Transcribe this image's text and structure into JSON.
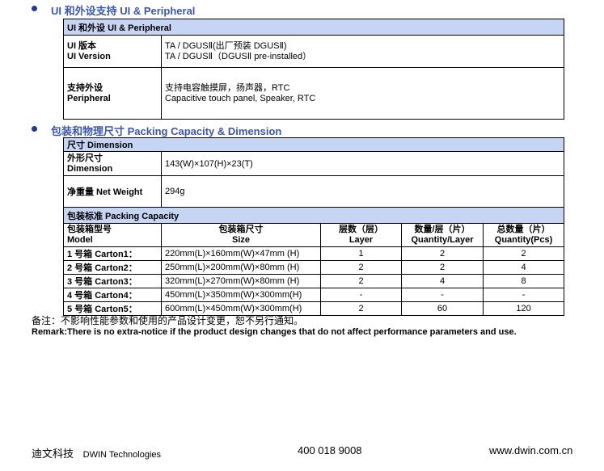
{
  "section_ui": {
    "title": "UI 和外设支持  UI & Peripheral",
    "header": "UI 和外设  UI & Peripheral",
    "rows": [
      {
        "label_cn": "UI 版本",
        "label_en": "UI Version",
        "value_cn": "TA / DGUSⅡ(出厂预装 DGUSⅡ)",
        "value_en": "TA / DGUSⅡ（DGUSⅡ pre-installed）"
      },
      {
        "label_cn": "支持外设",
        "label_en": "Peripheral",
        "value_cn": "支持电容触摸屏，扬声器，RTC",
        "value_en": "Capacitive touch panel, Speaker, RTC"
      }
    ]
  },
  "section_pack": {
    "title": "包装和物理尺寸  Packing Capacity & Dimension",
    "dimension_header": "尺寸  Dimension",
    "dim_rows": [
      {
        "label_cn": "外形尺寸",
        "label_en": "Dimension",
        "value": "143(W)×107(H)×23(T)"
      },
      {
        "label": "净重量  Net Weight",
        "value": "294g"
      }
    ],
    "packing_header": "包装标准  Packing Capacity",
    "columns": [
      {
        "cn": "包装箱型号",
        "en": "Model"
      },
      {
        "cn": "包装箱尺寸",
        "en": "Size"
      },
      {
        "cn": "层数（层）",
        "en": "Layer"
      },
      {
        "cn": "数量/层（片）",
        "en": "Quantity/Layer"
      },
      {
        "cn": "总数量（片）",
        "en": "Quantity(Pcs)"
      }
    ],
    "rows": [
      {
        "model": "1 号箱  Carton1：",
        "size": "220mm(L)×160mm(W)×47mm (H)",
        "layer": "1",
        "qty_layer": "2",
        "qty": "2"
      },
      {
        "model": "2 号箱  Carton2：",
        "size": "250mm(L)×200mm(W)×80mm (H)",
        "layer": "2",
        "qty_layer": "2",
        "qty": "4"
      },
      {
        "model": "3 号箱  Carton3：",
        "size": "320mm(L)×270mm(W)×80mm (H)",
        "layer": "2",
        "qty_layer": "4",
        "qty": "8"
      },
      {
        "model": "4 号箱  Carton4：",
        "size": "450mm(L)×350mm(W)×300mm(H)",
        "layer": "-",
        "qty_layer": "-",
        "qty": "-"
      },
      {
        "model": "5 号箱  Carton5：",
        "size": "600mm(L)×450mm(W)×300mm(H)",
        "layer": "2",
        "qty_layer": "60",
        "qty": "120"
      }
    ]
  },
  "remark": {
    "cn": "备注：不影响性能参数和使用的产品设计变更，恕不另行通知。",
    "en": "Remark:There is no extra-notice if the product design changes that do not affect performance parameters and use."
  },
  "footer": {
    "company_cn": "迪文科技",
    "company_en": "DWIN Technologies",
    "phone": "400 018 9008",
    "website": "www.dwin.com.cn"
  },
  "colors": {
    "heading": "#3b56b0",
    "header_bg": "#c6d5f3",
    "bullet": "#1f3a8f"
  }
}
